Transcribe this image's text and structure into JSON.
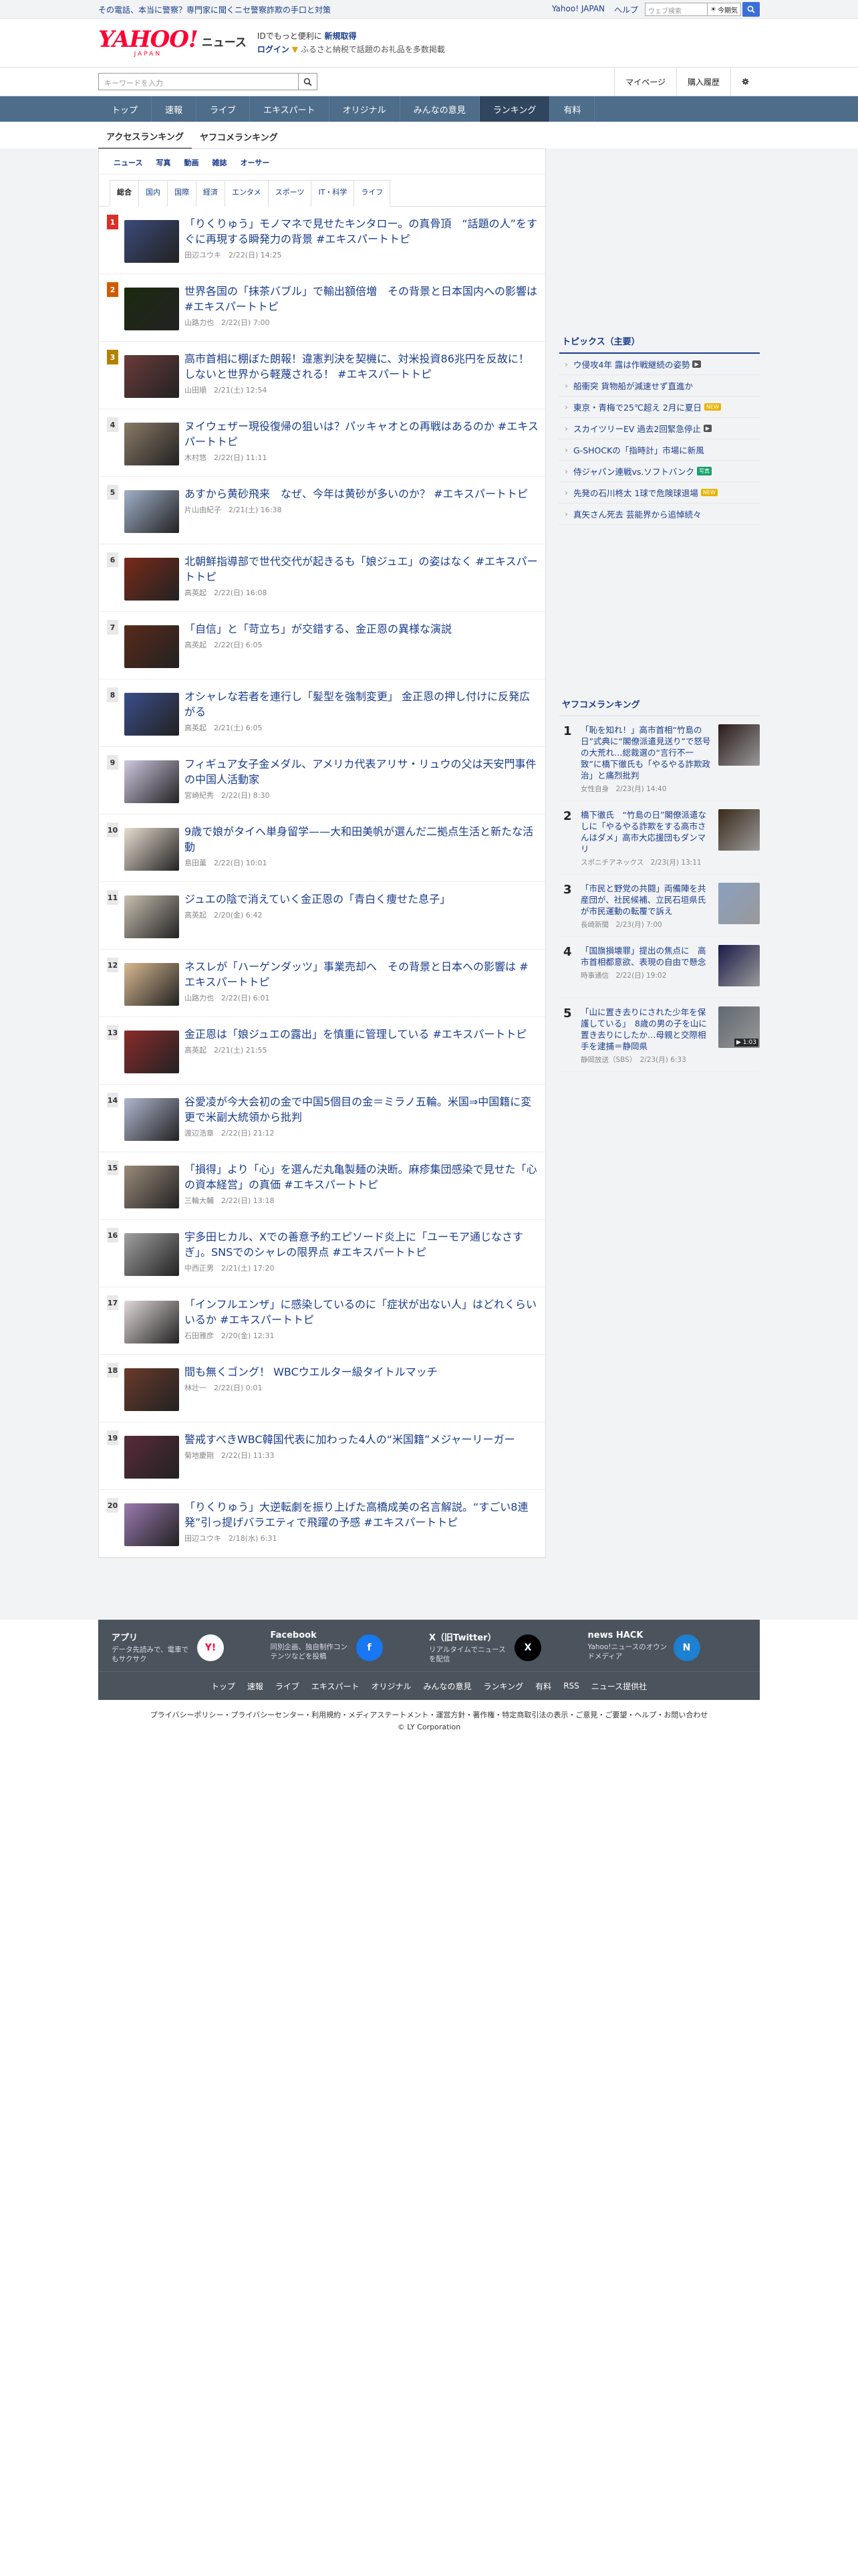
{
  "topbar": {
    "notice": "その電話、本当に警察？専門家に聞くニセ警察詐欺の手口と対策",
    "links": [
      "Yahoo! JAPAN",
      "ヘルプ"
    ],
    "search_placeholder": "ウェブ検索",
    "today_label": "今期気"
  },
  "header": {
    "logo_main": "YAHOO!",
    "logo_sub": "JAPAN",
    "logo_news": "ニュース",
    "promo_line1_pre": "IDでもっと便利に",
    "promo_line1_link": "新規取得",
    "promo_line2_login": "ログイン",
    "promo_line2_rest": "ふるさと納税で話題のお礼品を多数掲載"
  },
  "searchrow": {
    "placeholder": "キーワードを入力",
    "mypage": "マイページ",
    "history": "購入履歴"
  },
  "nav": [
    "トップ",
    "速報",
    "ライブ",
    "エキスパート",
    "オリジナル",
    "みんなの意見",
    "ランキング",
    "有料"
  ],
  "nav_active": "ランキング",
  "subtabs": [
    "アクセスランキング",
    "ヤフコメランキング"
  ],
  "categories": [
    "ニュース",
    "写真",
    "動画",
    "雑誌",
    "オーサー"
  ],
  "genres": [
    "総合",
    "国内",
    "国際",
    "経済",
    "エンタメ",
    "スポーツ",
    "IT・科学",
    "ライフ"
  ],
  "ranking": [
    {
      "rank": "1",
      "title": "「りくりゅう」モノマネで見せたキンタロー。の真骨頂　“話題の人”をすぐに再現する瞬発力の背景 #エキスパートトピ",
      "meta": "田辺ユウキ　2/22(日) 14:25"
    },
    {
      "rank": "2",
      "title": "世界各国の「抹茶バブル」で輸出額倍増　その背景と日本国内への影響は #エキスパートトピ",
      "meta": "山路力也　2/22(日) 7:00"
    },
    {
      "rank": "3",
      "title": "高市首相に棚ぼた朗報！違憲判決を契機に、対米投資86兆円を反故に！しないと世界から軽蔑される！ #エキスパートトピ",
      "meta": "山田順　2/21(土) 12:54"
    },
    {
      "rank": "4",
      "title": "ヌイウェザー現役復帰の狙いは？パッキャオとの再戦はあるのか #エキスパートトピ",
      "meta": "木村悠　2/22(日) 11:11"
    },
    {
      "rank": "5",
      "title": "あすから黄砂飛来　なぜ、今年は黄砂が多いのか？ #エキスパートトピ",
      "meta": "片山由紀子　2/21(土) 16:38"
    },
    {
      "rank": "6",
      "title": "北朝鮮指導部で世代交代が起きるも「娘ジュエ」の姿はなく #エキスパートトピ",
      "meta": "高英起　2/22(日) 16:08"
    },
    {
      "rank": "7",
      "title": "「自信」と「苛立ち」が交錯する、金正恩の異様な演説",
      "meta": "高英起　2/22(日) 6:05"
    },
    {
      "rank": "8",
      "title": "オシャレな若者を連行し「髪型を強制変更」 金正恩の押し付けに反発広がる",
      "meta": "高英起　2/21(土) 6:05"
    },
    {
      "rank": "9",
      "title": "フィギュア女子金メダル、アメリカ代表アリサ・リュウの父は天安門事件の中国人活動家",
      "meta": "宮崎紀秀　2/22(日) 8:30"
    },
    {
      "rank": "10",
      "title": "9歳で娘がタイへ単身留学——大和田美帆が選んだ二拠点生活と新たな活動",
      "meta": "島田薫　2/22(日) 10:01"
    },
    {
      "rank": "11",
      "title": "ジュエの陰で消えていく金正恩の「青白く痩せた息子」",
      "meta": "高英起　2/20(金) 6:42"
    },
    {
      "rank": "12",
      "title": "ネスレが「ハーゲンダッツ」事業売却へ　その背景と日本への影響は #エキスパートトピ",
      "meta": "山路力也　2/22(日) 6:01"
    },
    {
      "rank": "13",
      "title": "金正恩は「娘ジュエの露出」を慎重に管理している #エキスパートトピ",
      "meta": "高英起　2/21(土) 21:55"
    },
    {
      "rank": "14",
      "title": "谷愛凌が今大会初の金で中国5個目の金＝ミラノ五輪。米国⇒中国籍に変更で米副大統領から批判",
      "meta": "渡辺浩章　2/22(日) 21:12"
    },
    {
      "rank": "15",
      "title": "「損得」より「心」を選んだ丸亀製麺の決断。麻疹集団感染で見せた「心の資本経営」の真価 #エキスパートトピ",
      "meta": "三輪大輔　2/22(日) 13:18"
    },
    {
      "rank": "16",
      "title": "宇多田ヒカル、Xでの善意予約エピソード炎上に「ユーモア通じなさすぎ」。SNSでのシャレの限界点 #エキスパートトピ",
      "meta": "中西正男　2/21(土) 17:20"
    },
    {
      "rank": "17",
      "title": "「インフルエンザ」に感染しているのに「症状が出ない人」はどれくらいいるか #エキスパートトピ",
      "meta": "石田雅彦　2/20(金) 12:31"
    },
    {
      "rank": "18",
      "title": "間も無くゴング！ WBCウエルター級タイトルマッチ",
      "meta": "林壮一　2/22(日) 0:01"
    },
    {
      "rank": "19",
      "title": "警戒すべきWBC韓国代表に加わった4人の“米国籍”メジャーリーガー",
      "meta": "菊地慶剛　2/22(日) 11:33"
    },
    {
      "rank": "20",
      "title": "「りくりゅう」大逆転劇を振り上げた高橋成美の名言解説。“すごい8連発”引っ提げバラエティで飛躍の予感 #エキスパートトピ",
      "meta": "田辺ユウキ　2/18(水) 6:31"
    }
  ],
  "topics": {
    "title": "トピックス（主要）",
    "items": [
      {
        "text": "ウ侵攻4年 露は作戦継続の姿勢",
        "tag": "video",
        "tag_label": "▶"
      },
      {
        "text": "船衝突 貨物船が減速せず直進か",
        "tag": "",
        "tag_label": ""
      },
      {
        "text": "東京・青梅で25℃超え 2月に夏日",
        "tag": "new",
        "tag_label": "NEW"
      },
      {
        "text": "スカイツリーEV 過去2回緊急停止",
        "tag": "video",
        "tag_label": "▶"
      },
      {
        "text": "G-SHOCKの「指時計」市場に新風",
        "tag": "",
        "tag_label": ""
      },
      {
        "text": "侍ジャパン連戦vs.ソフトバンク",
        "tag": "pic",
        "tag_label": "写真"
      },
      {
        "text": "先発の石川柊太 1球で危険球退場",
        "tag": "new",
        "tag_label": "NEW"
      },
      {
        "text": "真矢さん死去 芸能界から追悼続々",
        "tag": "",
        "tag_label": ""
      }
    ]
  },
  "yahocome": {
    "title": "ヤフコメランキング",
    "items": [
      {
        "rank": "1",
        "title": "「恥を知れ！」高市首相“竹島の日”式典に“閣僚派遣見送り”で怒号の大荒れ…総裁選の“言行不一致”に橋下徹氏も「やるやる詐欺政治」と痛烈批判",
        "meta": "女性自身　2/23(月) 14:40",
        "dur": ""
      },
      {
        "rank": "2",
        "title": "橋下徹氏　“竹島の日”閣僚派遣なしに「やるやる詐欺をする高市さんはダメ」高市大応援団もダンマリ",
        "meta": "スポニチアネックス　2/23(月) 13:11",
        "dur": ""
      },
      {
        "rank": "3",
        "title": "「市民と野党の共闘」両備陣を共産団が、社民候補、立民石垣県氏が市民運動の転覆で訴え",
        "meta": "長崎新聞　2/23(月) 7:00",
        "dur": ""
      },
      {
        "rank": "4",
        "title": "「国旗損壊罪」提出の焦点に　高市首相都意欲、表現の自由で懸念",
        "meta": "時事通信　2/22(日) 19:02",
        "dur": ""
      },
      {
        "rank": "5",
        "title": "「山に置き去りにされた少年を保護している」　8歳の男の子を山に置き去りにしたか…母親と交際相手を逮捕＝静岡県",
        "meta": "静岡放送（SBS）　2/23(月) 6:33",
        "dur": "▶ 1:03"
      }
    ]
  },
  "footer": {
    "apps": [
      {
        "title": "アプリ",
        "desc": "データ先読みで、電車でもサクサク",
        "icon": "app-icon"
      },
      {
        "title": "Facebook",
        "desc": "同別企画、独自制作コンテンツなどを投稿",
        "icon": "facebook-icon"
      },
      {
        "title": "X（旧Twitter）",
        "desc": "リアルタイムでニュースを配信",
        "icon": "x-icon"
      },
      {
        "title": "news HACK",
        "desc": "Yahoo!ニュースのオウンドメディア",
        "icon": "newshack-icon"
      }
    ],
    "links": [
      "トップ",
      "速報",
      "ライブ",
      "エキスパート",
      "オリジナル",
      "みんなの意見",
      "ランキング",
      "有料",
      "RSS",
      "ニュース提供社"
    ],
    "legal": "プライバシーポリシー・プライバシーセンター・利用規約・メディアステートメント・運営方針・著作権・特定商取引法の表示・ご意見・ご要望・ヘルプ・お問い合わせ",
    "copyright": "© LY Corporation"
  },
  "colors": {
    "link": "#1a3c8c",
    "nav_bg": "#4e6d8b",
    "nav_active": "#30465e",
    "rank1": "#d93025",
    "rank2": "#d05a00",
    "rank3": "#b58100"
  }
}
